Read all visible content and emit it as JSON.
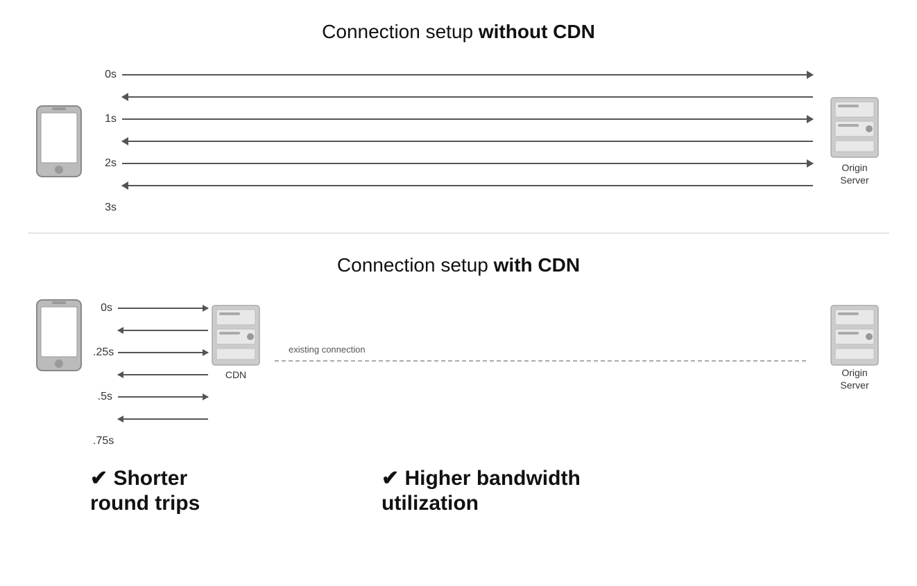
{
  "top": {
    "title_normal": "Connection setup ",
    "title_bold": "without CDN",
    "times": [
      "0s",
      "1s",
      "2s",
      "3s"
    ],
    "server_label": "Origin\nServer"
  },
  "bottom": {
    "title_normal": "Connection setup ",
    "title_bold": "with CDN",
    "times": [
      "0s",
      ".25s",
      ".5s",
      ".75s"
    ],
    "cdn_label": "CDN",
    "existing_label": "existing connection",
    "server_label": "Origin\nServer",
    "benefit1": "✔ Shorter\nround trips",
    "benefit2": "✔ Higher bandwidth\nutilization"
  }
}
